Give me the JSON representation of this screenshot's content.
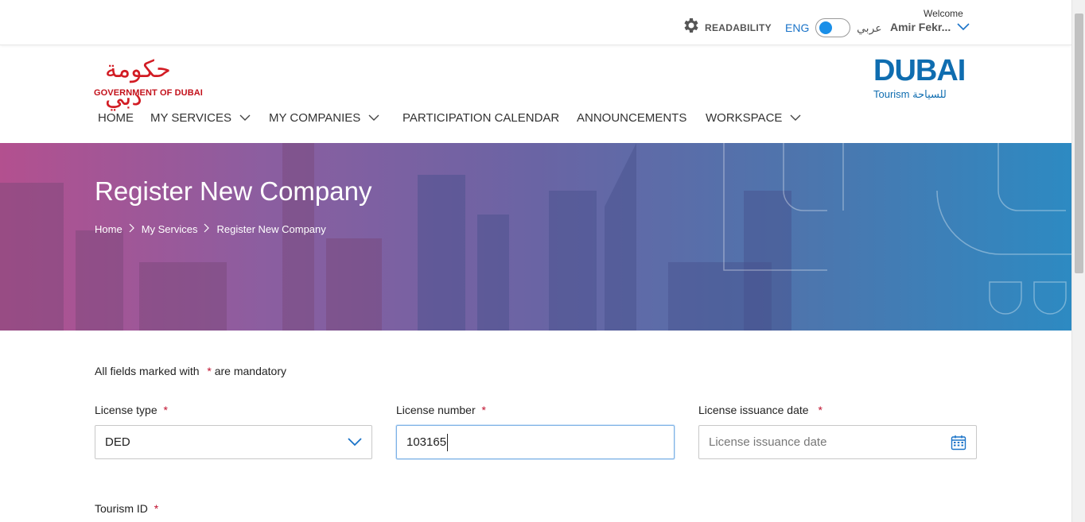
{
  "topbar": {
    "readability_label": "READABILITY",
    "lang_eng": "ENG",
    "lang_ar": "عربي",
    "welcome": "Welcome",
    "username": "Amir Fekr..."
  },
  "logos": {
    "gov_arabic": "حكومة دبي",
    "gov_english": "GOVERNMENT OF DUBAI",
    "tourism_title": "DUBAI",
    "tourism_sub": "Tourism للسياحة"
  },
  "nav": {
    "items": [
      {
        "label": "HOME",
        "dropdown": false
      },
      {
        "label": "MY SERVICES",
        "dropdown": true
      },
      {
        "label": "MY COMPANIES",
        "dropdown": true
      },
      {
        "label": "PARTICIPATION CALENDAR",
        "dropdown": false
      },
      {
        "label": "ANNOUNCEMENTS",
        "dropdown": false
      },
      {
        "label": "WORKSPACE",
        "dropdown": true
      }
    ]
  },
  "banner": {
    "title": "Register New Company",
    "breadcrumb": [
      "Home",
      "My Services",
      "Register New Company"
    ]
  },
  "form": {
    "mandatory_prefix": "All fields marked with",
    "mandatory_star": "*",
    "mandatory_suffix": "are mandatory",
    "license_type": {
      "label": "License type",
      "value": "DED"
    },
    "license_number": {
      "label": "License number",
      "value": "103165"
    },
    "license_issuance_date": {
      "label": "License issuance date",
      "placeholder": "License issuance date"
    },
    "tourism_id": {
      "label": "Tourism ID"
    }
  },
  "colors": {
    "accent": "#1a8fe8",
    "brand_red": "#d21c24",
    "brand_blue": "#0f6db0",
    "required_star": "#c0102e"
  }
}
